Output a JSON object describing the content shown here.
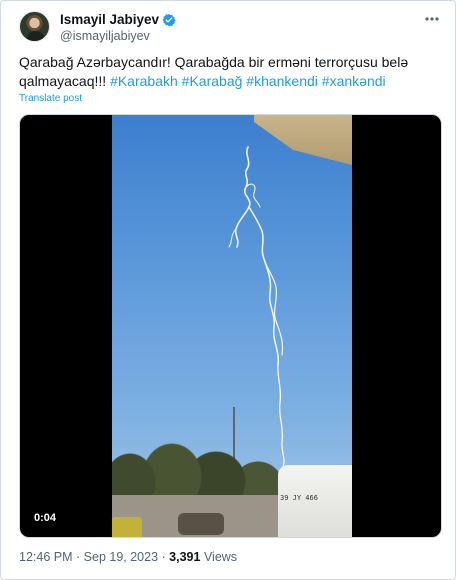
{
  "author": {
    "display_name": "Ismayil Jabiyev",
    "handle": "@ismayiljabiyev",
    "verified": true,
    "icons": {
      "avatar": "avatar-photo",
      "verified": "verified-badge-icon",
      "more": "more-horizontal-icon"
    }
  },
  "post": {
    "text_plain": "Qarabağ Azərbaycandır! Qarabağda bir erməni terrorçusu belə qalmayacaq!!!",
    "hashtags": [
      "#Karabakh",
      "#Karabağ",
      "#khankendi",
      "#xankəndi"
    ],
    "translate_label": "Translate post"
  },
  "media": {
    "duration": "0:04",
    "van_plate": "39 JY 466"
  },
  "footer": {
    "time": "12:46 PM",
    "separator": "·",
    "date": "Sep 19, 2023",
    "views_count": "3,391",
    "views_label": "Views"
  },
  "colors": {
    "link": "#1d9bf0",
    "text": "#0f1419",
    "muted": "#536471",
    "border": "#cfd9de",
    "verified": "#1d9bf0"
  }
}
